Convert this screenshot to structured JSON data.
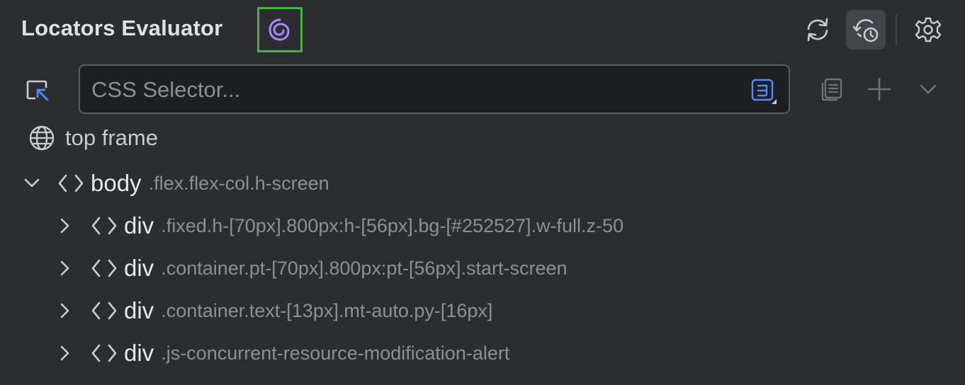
{
  "header": {
    "title": "Locators Evaluator",
    "logo_icon": "swirl-logo-icon",
    "actions": [
      {
        "name": "refresh-icon",
        "active": false
      },
      {
        "name": "history-refresh-icon",
        "active": true
      },
      {
        "name": "gear-icon",
        "active": false
      }
    ]
  },
  "selector": {
    "placeholder": "CSS Selector...",
    "value": "",
    "type_icon": "css3-icon"
  },
  "frame": {
    "label": "top frame",
    "icon": "globe-icon"
  },
  "tree": {
    "root": {
      "tag": "body",
      "classes": ".flex.flex-col.h-screen",
      "expanded": true
    },
    "children": [
      {
        "tag": "div",
        "classes": ".fixed.h-[70px].800px:h-[56px].bg-[#252527].w-full.z-50",
        "expanded": false
      },
      {
        "tag": "div",
        "classes": ".container.pt-[70px].800px:pt-[56px].start-screen",
        "expanded": false
      },
      {
        "tag": "div",
        "classes": ".container.text-[13px].mt-auto.py-[16px]",
        "expanded": false
      },
      {
        "tag": "div",
        "classes": ".js-concurrent-resource-modification-alert",
        "expanded": false
      }
    ]
  },
  "colors": {
    "background": "#2b2d30",
    "accent_highlight": "#4cae4f",
    "logo": "#a889ff",
    "css_icon": "#548af7"
  }
}
